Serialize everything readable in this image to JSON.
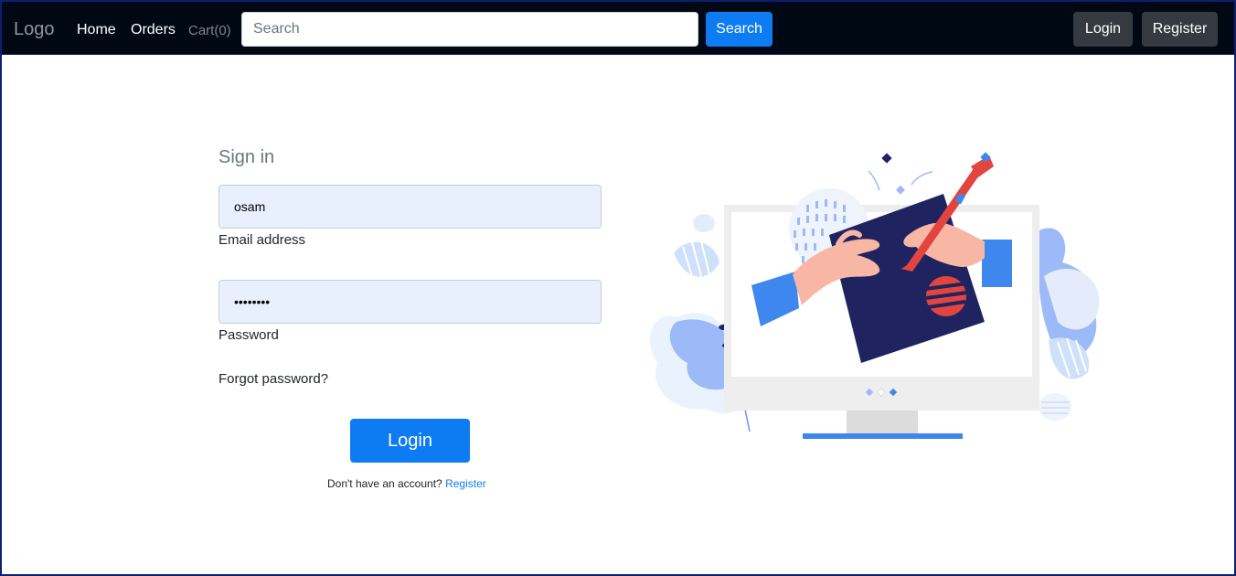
{
  "navbar": {
    "brand": "Logo",
    "links": {
      "home": "Home",
      "orders": "Orders",
      "cart": "Cart(0)"
    },
    "search": {
      "placeholder": "Search",
      "value": "",
      "button_label": "Search"
    },
    "login_label": "Login",
    "register_label": "Register"
  },
  "form": {
    "title": "Sign in",
    "email": {
      "value": "osam",
      "label": "Email address"
    },
    "password": {
      "value": "••••••••",
      "label": "Password"
    },
    "forgot_label": "Forgot password?",
    "login_button": "Login",
    "no_account_text": "Don't have an account?",
    "register_link": "Register"
  },
  "colors": {
    "navbar_bg": "#000814",
    "primary": "#0d7cf2",
    "dark_button": "#343a40",
    "input_bg": "#e8f0fe",
    "illustration_navy": "#1f2460",
    "illustration_red": "#e2453f",
    "illustration_blue": "#3d87ef"
  },
  "illustration": {
    "icon": "signin-computer-illustration"
  }
}
